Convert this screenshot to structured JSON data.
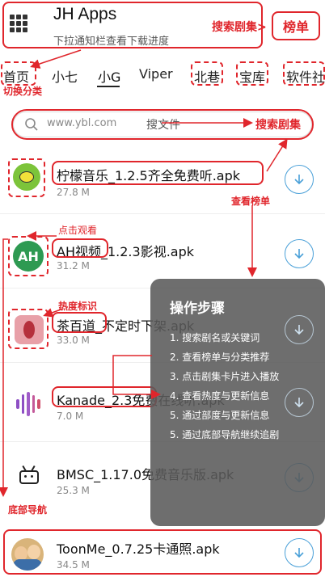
{
  "header": {
    "title": "JH Apps",
    "subtitle": "下拉通知栏查看下载进度",
    "search_series_label": "搜索剧集>",
    "ranking_button": "榜单"
  },
  "tabs": [
    {
      "label": "首页"
    },
    {
      "label": "小七"
    },
    {
      "label": "小G"
    },
    {
      "label": "Viper"
    },
    {
      "label": "北巷"
    },
    {
      "label": "宝库"
    },
    {
      "label": "软件社"
    }
  ],
  "search": {
    "placeholder": "www.ybl.com",
    "action_label": "搜文件"
  },
  "annotations": {
    "switch_category": "切换分类",
    "search_series": "搜索剧集",
    "view_ranking": "查看榜单",
    "click_to_watch": "点击观看",
    "heat_tag": "热度标识",
    "bottom_nav": "底部导航"
  },
  "apps": [
    {
      "name": "柠檬音乐_1.2.5齐全免费听.apk",
      "size": "27.8 M",
      "icon": "lemon-icon"
    },
    {
      "name": "AH视频_1.2.3影视.apk",
      "size": "31.2 M",
      "icon": "ah-video-icon",
      "icon_text": "AH"
    },
    {
      "name": "茶百道_不定时下架.apk",
      "size": "33.0 M",
      "icon": "chabaidao-icon"
    },
    {
      "name": "Kanade_2.3免费在线听.apk",
      "size": "7.0 M",
      "icon": "sound-wave-icon"
    },
    {
      "name": "BMSC_1.17.0免费音乐版.apk",
      "size": "25.3 M",
      "icon": "tv-icon"
    },
    {
      "name": "ToonMe_0.7.25卡通照.apk",
      "size": "34.5 M",
      "icon": "toonme-avatar-icon"
    }
  ],
  "overlay": {
    "title": "操作步骤",
    "steps": [
      "1. 搜索剧名或关键词",
      "2. 查看榜单与分类推荐",
      "3. 点击剧集卡片进入播放",
      "4. 查看热度与更新信息",
      "5. 通过部度与更新信息",
      "5. 通过底部导航继续追剧"
    ]
  },
  "colors": {
    "annotation_red": "#e0262c",
    "download_blue": "#4aa0d8",
    "overlay_bg": "#5a5a5a"
  }
}
